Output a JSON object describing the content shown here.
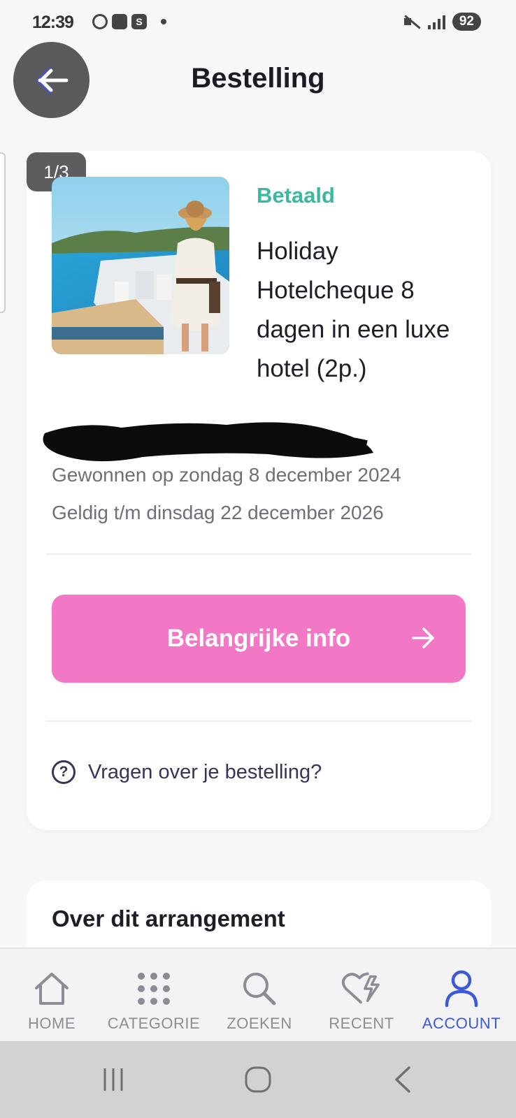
{
  "status_bar": {
    "time": "12:39",
    "left_icons": [
      "whatsapp-icon",
      "message-icon",
      "s-app-icon"
    ],
    "battery": "92"
  },
  "header": {
    "title": "Bestelling",
    "back_icon": "arrow-left-icon"
  },
  "order": {
    "page_indicator": "1/3",
    "status": "Betaald",
    "status_color": "#3db8a0",
    "title": "Holiday Hotelcheque 8 dagen in een luxe hotel (2p.)",
    "won_on": "Gewonnen op zondag 8 december 2024",
    "valid_until": "Geldig t/m dinsdag 22 december 2026",
    "info_button": "Belangrijke info",
    "info_button_color": "#f277c4",
    "help_text": "Vragen over je bestelling?"
  },
  "about": {
    "title": "Over dit arrangement"
  },
  "nav": {
    "items": [
      {
        "label": "HOME",
        "icon": "home-icon"
      },
      {
        "label": "CATEGORIE",
        "icon": "grid-icon"
      },
      {
        "label": "ZOEKEN",
        "icon": "search-icon"
      },
      {
        "label": "RECENT",
        "icon": "heart-lightning-icon"
      },
      {
        "label": "ACCOUNT",
        "icon": "user-icon"
      }
    ],
    "active": "ACCOUNT",
    "active_color": "#3c5ad8"
  }
}
